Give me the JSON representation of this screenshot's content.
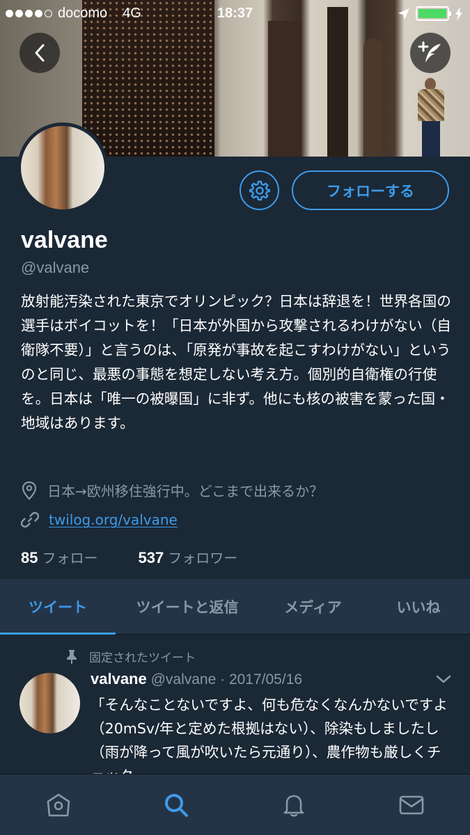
{
  "status_bar": {
    "carrier": "docomo",
    "network": "4G",
    "time": "18:37"
  },
  "profile": {
    "display_name": "valvane",
    "handle": "@valvane",
    "bio": "放射能汚染された東京でオリンピック？日本は辞退を！世界各国の選手はボイコットを！「日本が外国から攻撃されるわけがない（自衛隊不要）」と言うのは、「原発が事故を起こすわけがない」というのと同じ、最悪の事態を想定しない考え方。個別的自衛権の行使を。日本は「唯一の被曝国」に非ず。他にも核の被害を蒙った国・地域はあります。",
    "location": "日本→欧州移住強行中。どこまで出来るか？",
    "link": "twilog.org/valvane",
    "following_count": "85",
    "following_label": "フォロー",
    "followers_count": "537",
    "followers_label": "フォロワー",
    "follow_button": "フォローする"
  },
  "tabs": [
    {
      "label": "ツイート",
      "active": true
    },
    {
      "label": "ツイートと返信",
      "active": false
    },
    {
      "label": "メディア",
      "active": false
    },
    {
      "label": "いいね",
      "active": false
    }
  ],
  "pinned_tweet": {
    "pinned_label": "固定されたツイート",
    "author_name": "valvane",
    "author_handle_date": "@valvane · 2017/05/16",
    "text": "「そんなことないですよ、何も危なくなんかないですよ（20mSv/年と定めた根拠はない）、除染もしましたし（雨が降って風が吹いたら元通り）、農作物も厳しくチェック"
  },
  "icons": {
    "back": "back-arrow-icon",
    "compose": "compose-tweet-icon",
    "settings": "gear-icon",
    "location": "location-pin-icon",
    "link": "link-icon",
    "pin": "pin-icon",
    "chevron": "chevron-down-icon",
    "nav_home": "home-icon",
    "nav_search": "search-icon",
    "nav_notifications": "bell-icon",
    "nav_messages": "mail-icon"
  },
  "colors": {
    "background": "#1b2836",
    "panel": "#243447",
    "accent": "#3d9be9",
    "muted": "#8899a6",
    "battery": "#4cd964"
  },
  "battery_level": 1.0
}
